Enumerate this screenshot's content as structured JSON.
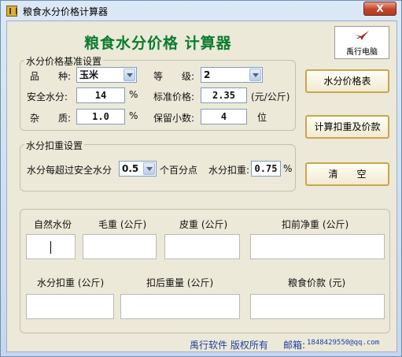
{
  "window": {
    "title": "粮食水分价格计算器",
    "close_label": "X"
  },
  "header": {
    "title": "粮食水分价格  计算器",
    "logo_text": "禹行电脑"
  },
  "base_settings": {
    "group_label": "水分价格基准设置",
    "variety_label": "品　　种:",
    "variety_value": "玉米",
    "grade_label": "等　　级:",
    "grade_value": "2",
    "safe_moisture_label": "安全水分:",
    "safe_moisture_value": "14",
    "safe_moisture_unit": "%",
    "standard_price_label": "标准价格:",
    "standard_price_value": "2.35",
    "standard_price_unit": "(元/公斤)",
    "impurity_label": "杂　　质:",
    "impurity_value": "1.0",
    "impurity_unit": "%",
    "decimals_label": "保留小数:",
    "decimals_value": "4",
    "decimals_unit": "位"
  },
  "deduction_settings": {
    "group_label": "水分扣重设置",
    "over_label": "水分每超过安全水分",
    "over_value": "0.5",
    "over_suffix": "个百分点",
    "deduct_label": "水分扣重:",
    "deduct_value": "0.75",
    "deduct_unit": "%"
  },
  "buttons": {
    "price_table": "水分价格表",
    "calculate": "计算扣重及价款",
    "clear": "清　　空"
  },
  "results": {
    "natural_moisture_label": "自然水份",
    "gross_weight_label": "毛重 (公斤)",
    "tare_weight_label": "皮重 (公斤)",
    "net_before_label": "扣前净重 (公斤)",
    "moisture_deduct_label": "水分扣重 (公斤)",
    "net_after_label": "扣后重量 (公斤)",
    "grain_price_label": "粮食价款 (元)"
  },
  "footer": {
    "copyright": "禹行软件  版权所有",
    "email_label": "邮箱:",
    "email": "1848429550@qq.com"
  }
}
